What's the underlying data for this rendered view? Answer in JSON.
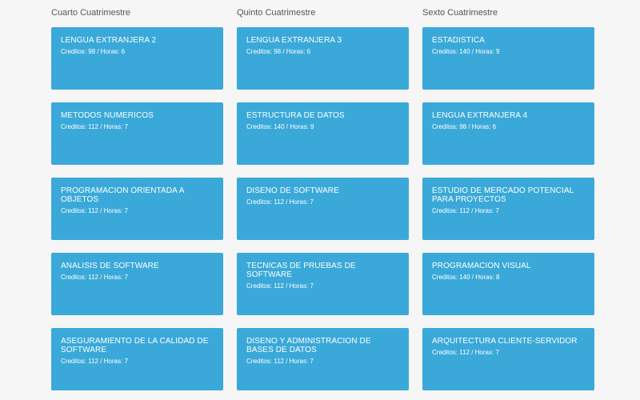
{
  "columns": [
    {
      "title": "Cuarto Cuatrimestre",
      "courses": [
        {
          "name": "LENGUA EXTRANJERA 2",
          "meta": "Creditos: 98 / Horas: 6"
        },
        {
          "name": "METODOS NUMERICOS",
          "meta": "Creditos: 112 / Horas: 7"
        },
        {
          "name": "PROGRAMACION ORIENTADA A OBJETOS",
          "meta": "Creditos: 112 / Horas: 7"
        },
        {
          "name": "ANALISIS DE SOFTWARE",
          "meta": "Creditos: 112 / Horas: 7"
        },
        {
          "name": "ASEGURAMIENTO DE LA CALIDAD DE SOFTWARE",
          "meta": "Creditos: 112 / Horas: 7"
        }
      ]
    },
    {
      "title": "Quinto Cuatrimestre",
      "courses": [
        {
          "name": "LENGUA EXTRANJERA 3",
          "meta": "Creditos: 98 / Horas: 6"
        },
        {
          "name": "ESTRUCTURA DE DATOS",
          "meta": "Creditos: 140 / Horas: 9"
        },
        {
          "name": "DISENO DE SOFTWARE",
          "meta": "Creditos: 112 / Horas: 7"
        },
        {
          "name": "TECNICAS DE PRUEBAS DE SOFTWARE",
          "meta": "Creditos: 112 / Horas: 7"
        },
        {
          "name": "DISENO Y ADMINISTRACION DE BASES DE DATOS",
          "meta": "Creditos: 112 / Horas: 7"
        }
      ]
    },
    {
      "title": "Sexto Cuatrimestre",
      "courses": [
        {
          "name": "ESTADISTICA",
          "meta": "Creditos: 140 / Horas: 9"
        },
        {
          "name": "LENGUA EXTRANJERA 4",
          "meta": "Creditos: 98 / Horas: 6"
        },
        {
          "name": "ESTUDIO DE MERCADO POTENCIAL PARA PROYECTOS",
          "meta": "Creditos: 112 / Horas: 7"
        },
        {
          "name": "PROGRAMACION VISUAL",
          "meta": "Creditos: 140 / Horas: 8"
        },
        {
          "name": "ARQUITECTURA CLIENTE-SERVIDOR",
          "meta": "Creditos: 112 / Horas: 7"
        }
      ]
    }
  ],
  "colors": {
    "card_background": "#3aa9d9",
    "card_text": "#ffffff",
    "heading_text": "#555555",
    "page_background": "#f6f6f6"
  }
}
